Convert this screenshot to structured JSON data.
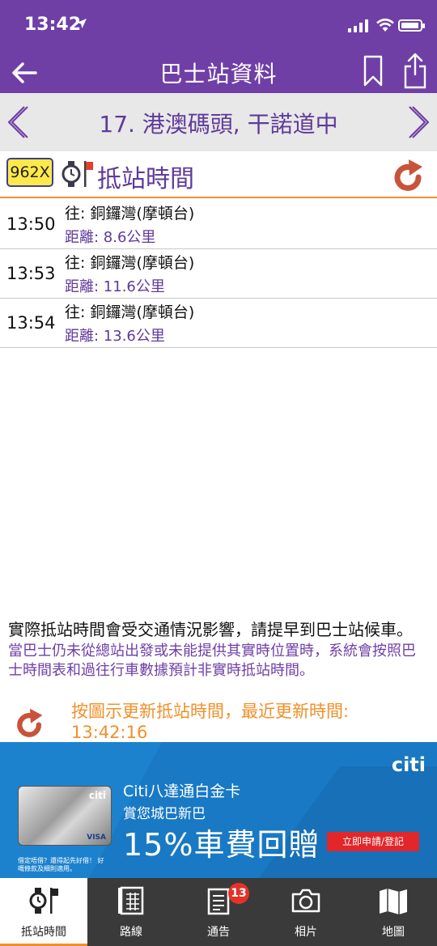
{
  "status_bar": {
    "time": "13:42"
  },
  "header": {
    "title": "巴士站資料"
  },
  "stop": {
    "name": "17. 港澳碼頭, 干諾道中"
  },
  "eta_section": {
    "route": "962X",
    "title": "抵站時間"
  },
  "arrivals": [
    {
      "time": "13:50",
      "destination": "往: 銅鑼灣(摩頓台)",
      "distance": "距離: 8.6公里"
    },
    {
      "time": "13:53",
      "destination": "往: 銅鑼灣(摩頓台)",
      "distance": "距離: 11.6公里"
    },
    {
      "time": "13:54",
      "destination": "往: 銅鑼灣(摩頓台)",
      "distance": "距離: 13.6公里"
    }
  ],
  "notes": {
    "traffic": "實際抵站時間會受交通情況影響，請提早到巴士站候車。",
    "scheduled": "當巴士仍未從總站出發或未能提供其實時位置時，系統會按照巴士時間表和過往行車數據預計非實時抵站時間。",
    "update": "按圖示更新抵站時間，最近更新時間: 13:42:16"
  },
  "ad": {
    "brand": "citi",
    "headline": "Citi八達通白金卡",
    "subline": "賞您城巴新巴",
    "offer": "15%車費回贈",
    "cta": "立即申請/登記",
    "card_brand": "citi",
    "card_network": "VISA",
    "fine_print": "借定唔借？還得起先好借！ 好嘅條款及細則適用。"
  },
  "tabs": [
    {
      "label": "抵站時間",
      "icon": "watch-flag-icon"
    },
    {
      "label": "路線",
      "icon": "timetable-icon"
    },
    {
      "label": "通告",
      "icon": "notice-icon"
    },
    {
      "label": "相片",
      "icon": "camera-icon"
    },
    {
      "label": "地圖",
      "icon": "map-icon"
    }
  ],
  "notice_badge": "13",
  "colors": {
    "primary": "#6f3fa6",
    "accent": "#f0902b",
    "refresh": "#c9533a",
    "ad_blue": "#1979c4"
  }
}
